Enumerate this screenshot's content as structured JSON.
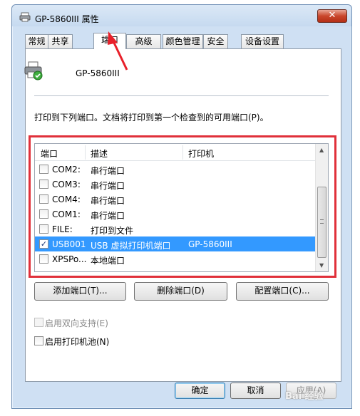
{
  "window": {
    "title": "GP-5860III 属性",
    "close_label": "✕"
  },
  "tabs": [
    {
      "label": "常规"
    },
    {
      "label": "共享"
    },
    {
      "label": "端口"
    },
    {
      "label": "高级"
    },
    {
      "label": "颜色管理"
    },
    {
      "label": "安全"
    },
    {
      "label": "设备设置"
    }
  ],
  "active_tab": "端口",
  "printer": {
    "name": "GP-5860III",
    "icon": "printer-icon"
  },
  "description": "打印到下列端口。文档将打印到第一个检查到的可用端口(P)。",
  "ports": {
    "columns": [
      "端口",
      "描述",
      "打印机"
    ],
    "rows": [
      {
        "port": "COM2:",
        "desc": "串行端口",
        "printer": "",
        "checked": false,
        "selected": false
      },
      {
        "port": "COM3:",
        "desc": "串行端口",
        "printer": "",
        "checked": false,
        "selected": false
      },
      {
        "port": "COM4:",
        "desc": "串行端口",
        "printer": "",
        "checked": false,
        "selected": false
      },
      {
        "port": "COM1:",
        "desc": "串行端口",
        "printer": "",
        "checked": false,
        "selected": false
      },
      {
        "port": "FILE:",
        "desc": "打印到文件",
        "printer": "",
        "checked": false,
        "selected": false
      },
      {
        "port": "USB001",
        "desc": "USB 虚拟打印机端口",
        "printer": "GP-5860III",
        "checked": true,
        "selected": true
      },
      {
        "port": "XPSPo...",
        "desc": "本地端口",
        "printer": "",
        "checked": false,
        "selected": false
      }
    ]
  },
  "port_buttons": {
    "add": "添加端口(T)...",
    "delete": "删除端口(D)",
    "configure": "配置端口(C)..."
  },
  "options": {
    "bidirectional": "启用双向支持(E)",
    "pooling": "启用打印机池(N)"
  },
  "footer": {
    "ok": "确定",
    "cancel": "取消",
    "apply": "应用(A)"
  },
  "watermark": "Bai 经验",
  "colors": {
    "selection": "#3399ff",
    "highlight_border": "#e0303a",
    "arrow": "#e8202a"
  }
}
